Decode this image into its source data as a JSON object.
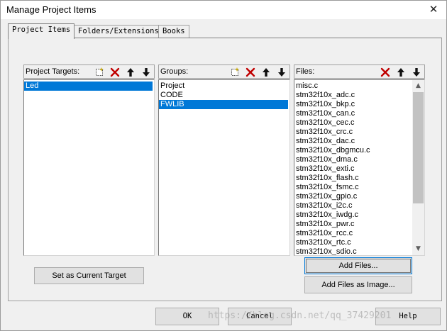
{
  "window": {
    "title": "Manage Project Items",
    "close_glyph": "✕"
  },
  "tabs": [
    {
      "label": "Project Items",
      "active": true
    },
    {
      "label": "Folders/Extensions",
      "active": false
    },
    {
      "label": "Books",
      "active": false
    }
  ],
  "project_targets": {
    "header": "Project Targets:",
    "items": [
      "Led"
    ],
    "selected": "Led",
    "toolbar": [
      "new-icon",
      "delete-icon",
      "move-up-icon",
      "move-down-icon"
    ]
  },
  "groups": {
    "header": "Groups:",
    "items": [
      "Project",
      "CODE",
      "FWLIB"
    ],
    "selected": "FWLIB",
    "toolbar": [
      "new-icon",
      "delete-icon",
      "move-up-icon",
      "move-down-icon"
    ]
  },
  "files": {
    "header": "Files:",
    "items": [
      "misc.c",
      "stm32f10x_adc.c",
      "stm32f10x_bkp.c",
      "stm32f10x_can.c",
      "stm32f10x_cec.c",
      "stm32f10x_crc.c",
      "stm32f10x_dac.c",
      "stm32f10x_dbgmcu.c",
      "stm32f10x_dma.c",
      "stm32f10x_exti.c",
      "stm32f10x_flash.c",
      "stm32f10x_fsmc.c",
      "stm32f10x_gpio.c",
      "stm32f10x_i2c.c",
      "stm32f10x_iwdg.c",
      "stm32f10x_pwr.c",
      "stm32f10x_rcc.c",
      "stm32f10x_rtc.c",
      "stm32f10x_sdio.c"
    ],
    "toolbar": [
      "delete-icon",
      "move-up-icon",
      "move-down-icon"
    ],
    "scroll_up_glyph": "▲",
    "scroll_down_glyph": "▼"
  },
  "buttons": {
    "set_current_target": "Set as Current Target",
    "add_files": "Add Files...",
    "add_files_as_image": "Add Files as Image...",
    "ok": "OK",
    "cancel": "Cancel",
    "help": "Help"
  },
  "watermark": "https://blog.csdn.net/qq_37429201",
  "colors": {
    "selection": "#0078d7",
    "delete": "#c00000",
    "new_icon": "#c8a800"
  }
}
